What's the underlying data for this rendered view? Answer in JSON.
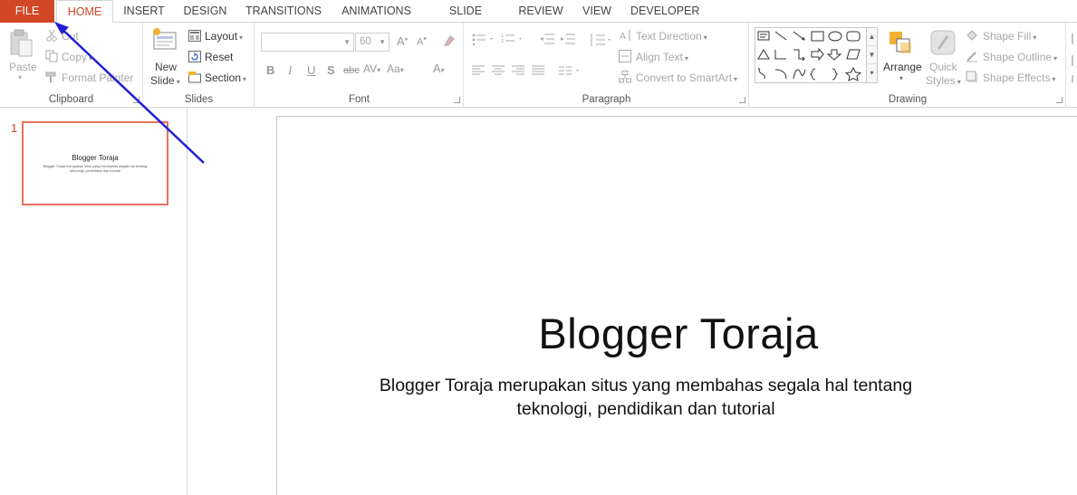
{
  "tabs": {
    "file": "FILE",
    "home": "HOME",
    "insert": "INSERT",
    "design": "DESIGN",
    "transitions": "TRANSITIONS",
    "animations": "ANIMATIONS",
    "slide_show": "SLIDE SHOW",
    "review": "REVIEW",
    "view": "VIEW",
    "developer": "DEVELOPER"
  },
  "clipboard": {
    "paste": "Paste",
    "cut": "Cut",
    "copy": "Copy",
    "format_painter": "Format Painter",
    "label": "Clipboard"
  },
  "slides": {
    "new_slide_line1": "New",
    "new_slide_line2": "Slide",
    "layout": "Layout",
    "reset": "Reset",
    "section": "Section",
    "label": "Slides"
  },
  "font": {
    "font_name": "",
    "font_size": "60",
    "label": "Font"
  },
  "paragraph": {
    "text_direction": "Text Direction",
    "align_text": "Align Text",
    "convert_smartart": "Convert to SmartArt",
    "label": "Paragraph"
  },
  "drawing": {
    "arrange": "Arrange",
    "quick_styles_line1": "Quick",
    "quick_styles_line2": "Styles",
    "shape_fill": "Shape Fill",
    "shape_outline": "Shape Outline",
    "shape_effects": "Shape Effects",
    "label": "Drawing"
  },
  "thumbnails": [
    {
      "number": "1",
      "title": "Blogger Toraja",
      "subtitle": "Blogger Toraja merupakan situs yang membahas segala hal tentang teknologi, pendidikan dan tutorial"
    }
  ],
  "slide": {
    "title": "Blogger Toraja",
    "subtitle_line1": "Blogger Toraja merupakan situs yang membahas segala hal tentang",
    "subtitle_line2": "teknologi, pendidikan dan tutorial"
  },
  "colors": {
    "accent": "#d24726",
    "thumb_border": "#e8735a",
    "annotation_arrow": "#1f1fd6"
  }
}
